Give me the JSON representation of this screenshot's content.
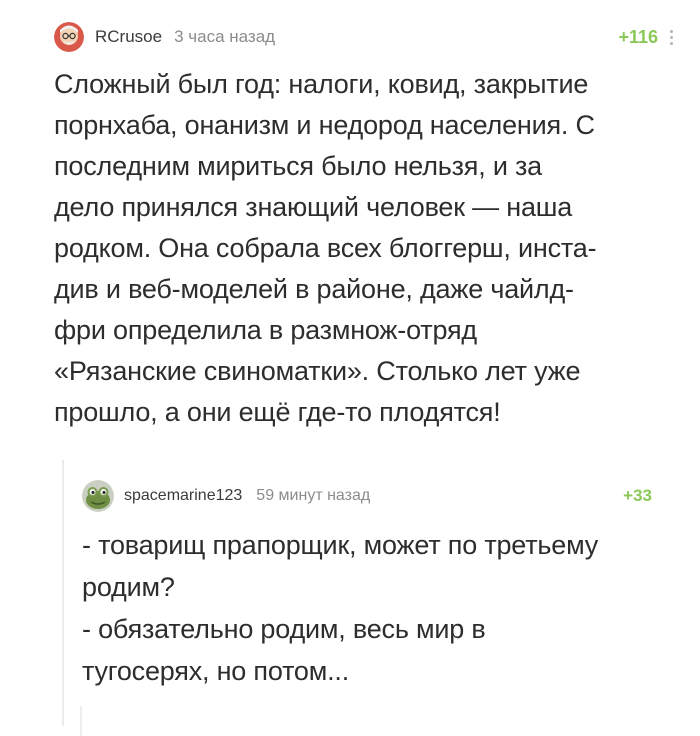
{
  "main_comment": {
    "author": "RCrusoe",
    "time": "3 часа назад",
    "rating": "+116",
    "avatar_icon": "grandpa-avatar-icon",
    "text": "Сложный был год: налоги, ковид, закрытие\nпорнхаба, онанизм и недород населения. С\nпоследним мириться было нельзя, и за\nдело принялся знающий человек — наша\nродком. Она собрала всех блоггерш, инста-\nдив и веб-моделей в районе, даже чайлд-\nфри определила в размнож-отряд\n«Рязанские свиноматки». Столько лет уже\nпрошло, а они ещё где-то плодятся!"
  },
  "reply_comment": {
    "author": "spacemarine123",
    "time": "59 минут назад",
    "rating": "+33",
    "avatar_icon": "frog-avatar-icon",
    "text": "- товарищ прапорщик, может по третьему\nродим?\n- обязательно родим, весь мир в\nтугосерях, но потом..."
  },
  "colors": {
    "rating_positive": "#8ac858",
    "meta_text": "#8c8c8c",
    "body_text": "#2d2d2d"
  },
  "icons": {
    "more": "more-vertical-icon"
  }
}
